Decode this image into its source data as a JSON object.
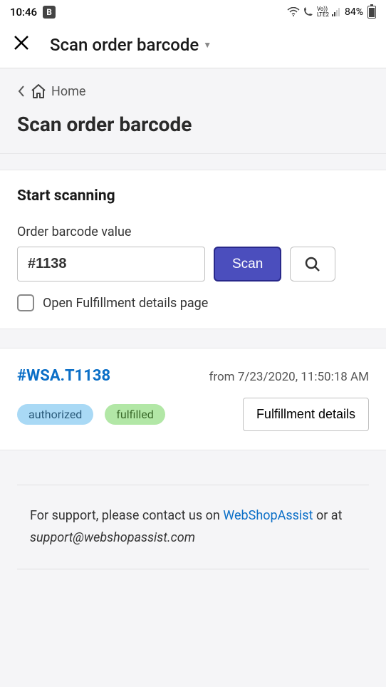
{
  "status_bar": {
    "time": "10:46",
    "b_badge": "B",
    "battery_pct": "84%"
  },
  "header": {
    "title": "Scan order barcode"
  },
  "breadcrumb": {
    "home": "Home"
  },
  "page": {
    "heading": "Scan order barcode"
  },
  "scan": {
    "section_title": "Start scanning",
    "input_label": "Order barcode value",
    "input_value": "#1138",
    "scan_button": "Scan",
    "checkbox_label": "Open Fulfillment details page"
  },
  "order": {
    "id": "#WSA.T1138",
    "from_prefix": "from ",
    "timestamp": "7/23/2020, 11:50:18 AM",
    "badge_auth": "authorized",
    "badge_fulfilled": "fulfilled",
    "details_button": "Fulfillment details"
  },
  "footer": {
    "support_prefix": "For support, please contact us on ",
    "support_link": "WebShopAssist",
    "support_mid": " or at ",
    "support_email": "support@webshopassist.com"
  }
}
